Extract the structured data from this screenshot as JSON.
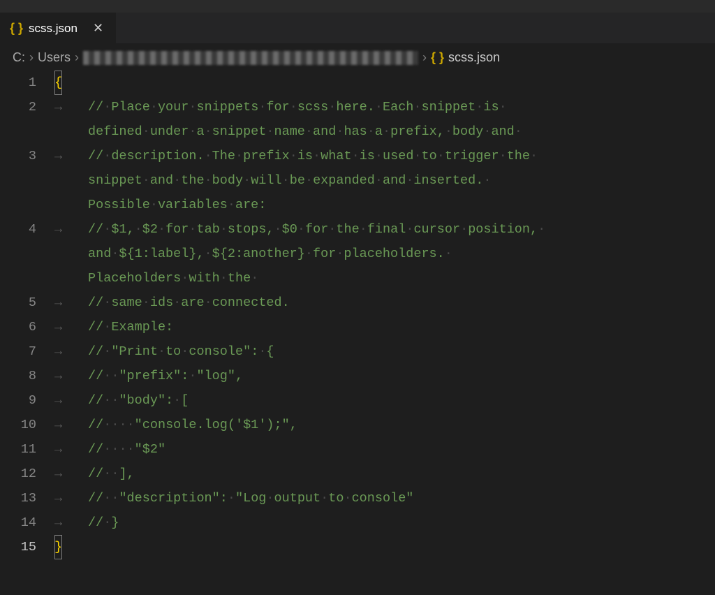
{
  "tab": {
    "filename": "scss.json",
    "icon": "{ }"
  },
  "breadcrumbs": {
    "root": "C:",
    "second": "Users",
    "filename": "scss.json",
    "icon": "{ }",
    "sep": "›"
  },
  "lines": [
    {
      "number": "1",
      "type": "brace",
      "text": "{"
    },
    {
      "number": "2",
      "type": "comment",
      "text": "// Place your snippets for scss here. Each snippet is ",
      "wrap": "defined under a snippet name and has a prefix, body and "
    },
    {
      "number": "3",
      "type": "comment",
      "text": "// description. The prefix is what is used to trigger the ",
      "wrap": "snippet and the body will be expanded and inserted. ",
      "wrap2": "Possible variables are:"
    },
    {
      "number": "4",
      "type": "comment",
      "text": "// $1, $2 for tab stops, $0 for the final cursor position, ",
      "wrap": "and ${1:label}, ${2:another} for placeholders. ",
      "wrap2": "Placeholders with the "
    },
    {
      "number": "5",
      "type": "comment",
      "text": "// same ids are connected."
    },
    {
      "number": "6",
      "type": "comment",
      "text": "// Example:"
    },
    {
      "number": "7",
      "type": "comment",
      "text": "// \"Print to console\": {"
    },
    {
      "number": "8",
      "type": "comment",
      "text": "//  \"prefix\": \"log\","
    },
    {
      "number": "9",
      "type": "comment",
      "text": "//  \"body\": ["
    },
    {
      "number": "10",
      "type": "comment",
      "text": "//    \"console.log('$1');\","
    },
    {
      "number": "11",
      "type": "comment",
      "text": "//    \"$2\""
    },
    {
      "number": "12",
      "type": "comment",
      "text": "//  ],"
    },
    {
      "number": "13",
      "type": "comment",
      "text": "//  \"description\": \"Log output to console\""
    },
    {
      "number": "14",
      "type": "comment",
      "text": "// }"
    },
    {
      "number": "15",
      "type": "brace",
      "text": "}"
    }
  ]
}
